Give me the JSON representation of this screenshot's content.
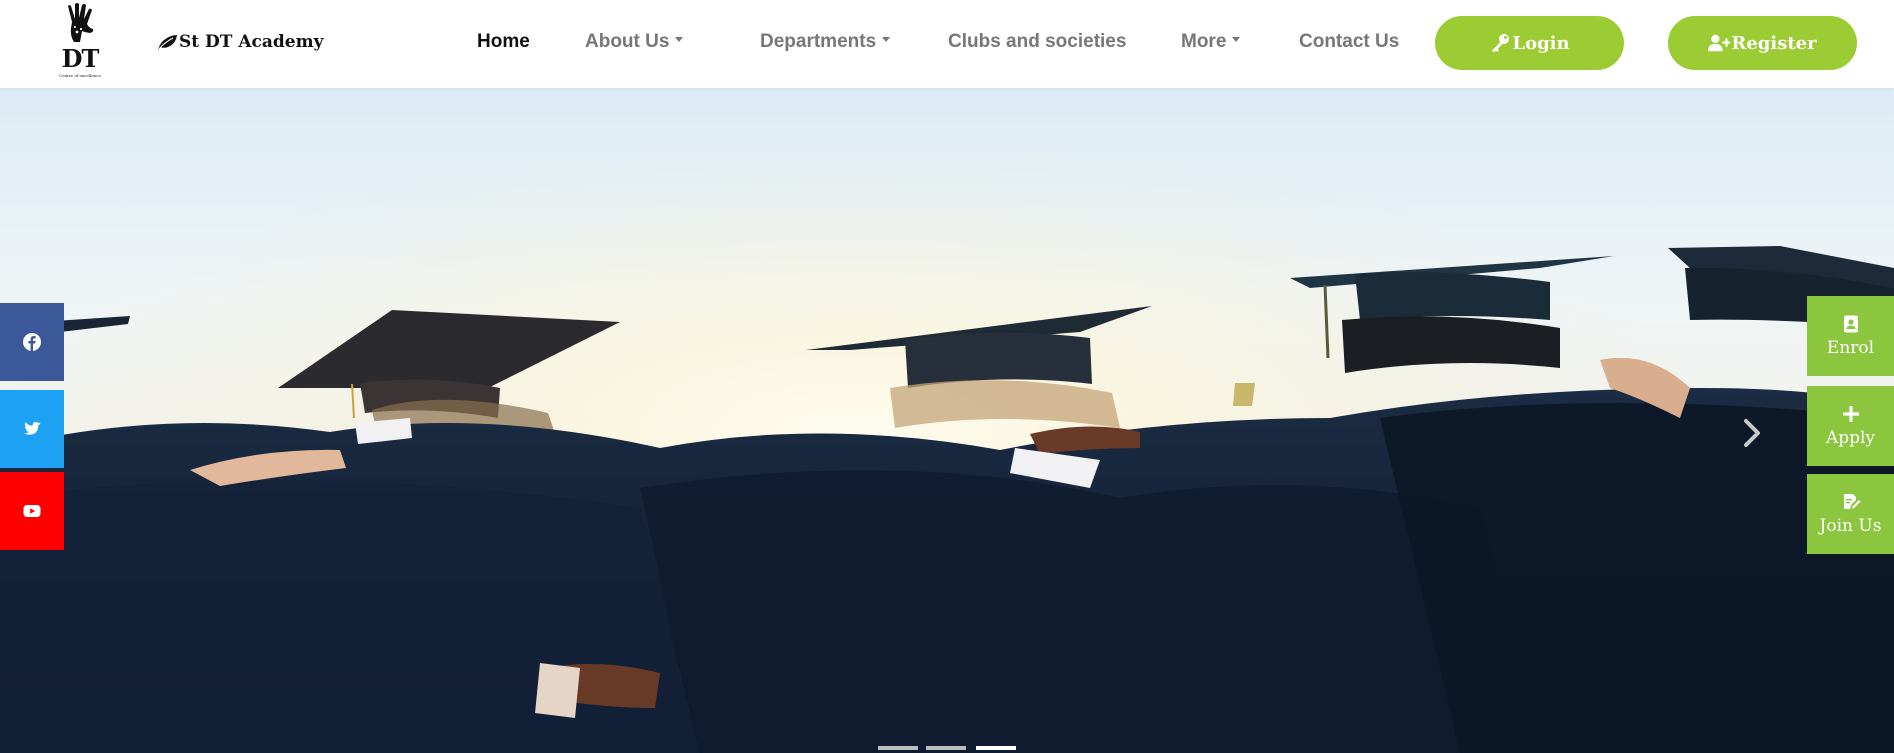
{
  "brand": {
    "logo_text": "DT",
    "logo_tagline": "Centre of excellence",
    "name": "St DT Academy"
  },
  "nav": {
    "items": [
      {
        "label": "Home",
        "active": true,
        "dropdown": false
      },
      {
        "label": "About Us",
        "active": false,
        "dropdown": true
      },
      {
        "label": "Departments",
        "active": false,
        "dropdown": true
      },
      {
        "label": "Clubs and societies",
        "active": false,
        "dropdown": false
      },
      {
        "label": "More",
        "active": false,
        "dropdown": true
      },
      {
        "label": "Contact Us",
        "active": false,
        "dropdown": false
      }
    ],
    "login_label": "Login",
    "register_label": "Register"
  },
  "social": [
    {
      "name": "facebook-icon",
      "color": "#3b5998"
    },
    {
      "name": "twitter-icon",
      "color": "#1da1f2"
    },
    {
      "name": "youtube-icon",
      "color": "#ff0000"
    }
  ],
  "quick_actions": [
    {
      "label": "Enrol",
      "icon": "contact-book-icon"
    },
    {
      "label": "Apply",
      "icon": "plus-icon"
    },
    {
      "label": "Join Us",
      "icon": "edit-document-icon"
    }
  ],
  "carousel": {
    "slide_count": 3,
    "active_slide": 3
  },
  "colors": {
    "accent_green": "#9ccc34",
    "quick_green": "#8cc63f",
    "nav_text": "#777777",
    "nav_active": "#111111"
  }
}
